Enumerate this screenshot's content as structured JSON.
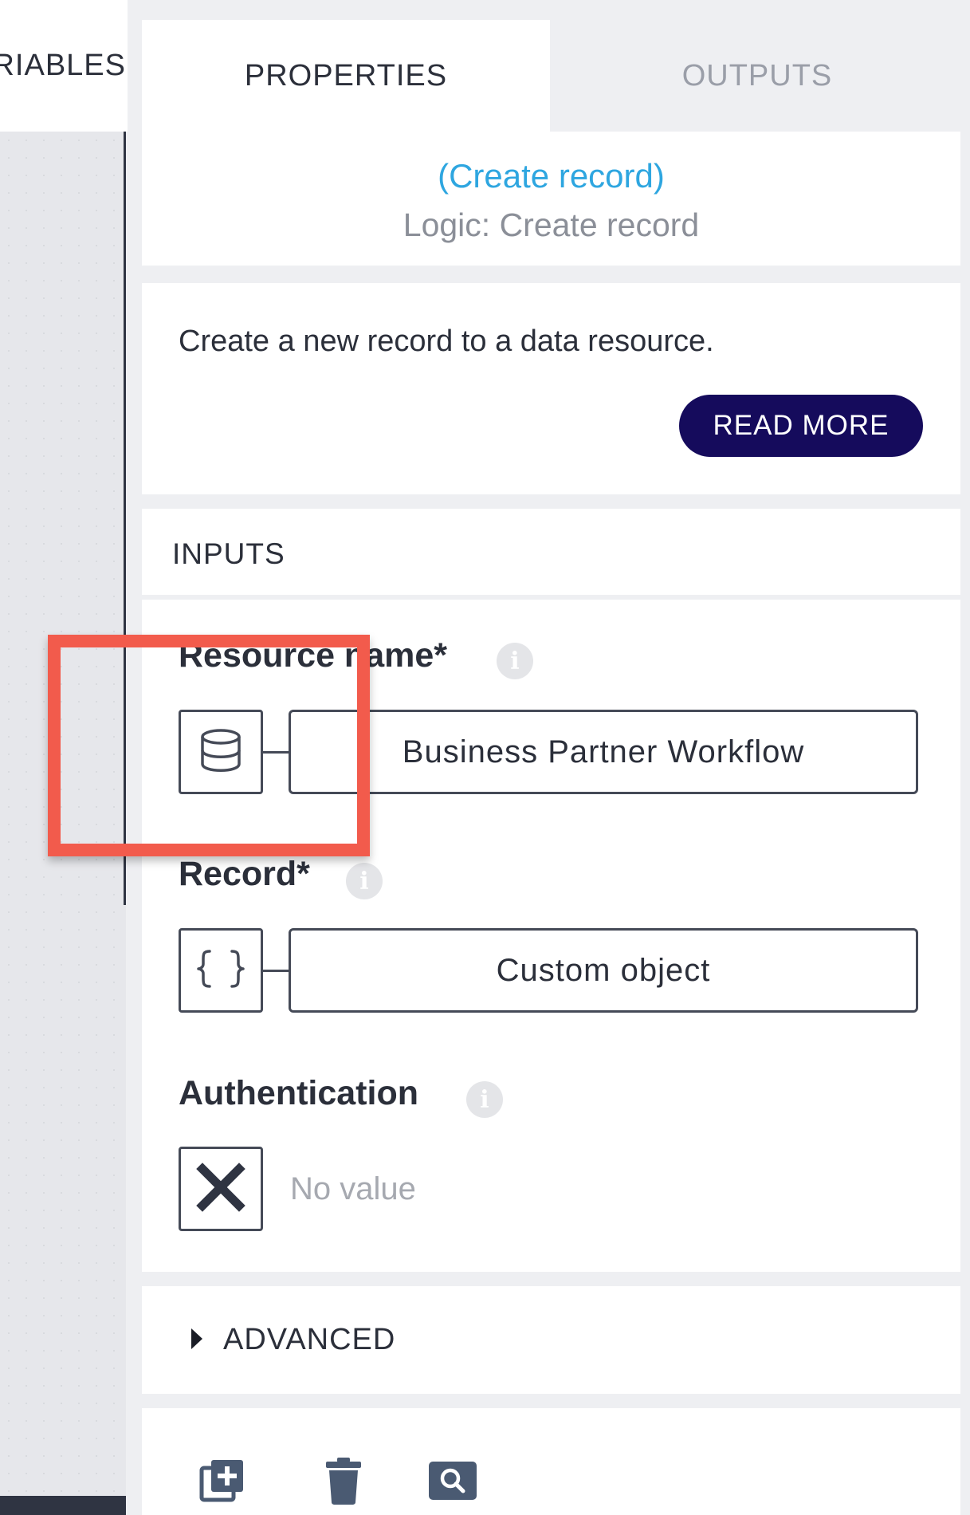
{
  "tabs": {
    "variables": "RIABLES",
    "properties": "PROPERTIES",
    "outputs": "OUTPUTS",
    "active": "PROPERTIES"
  },
  "header": {
    "record_link": "(Create record)",
    "subtitle": "Logic: Create record"
  },
  "description": {
    "text": "Create a new record to a data resource.",
    "read_more_label": "READ MORE"
  },
  "inputs": {
    "heading": "INPUTS",
    "fields": [
      {
        "label": "Resource name*",
        "type_icon": "database-icon",
        "value": "Business Partner Workflow"
      },
      {
        "label": "Record*",
        "type_icon": "braces-icon",
        "value": "Custom object"
      },
      {
        "label": "Authentication",
        "type_icon": "x-icon",
        "value": "No value"
      }
    ]
  },
  "advanced": {
    "label": "ADVANCED"
  },
  "toolbar": {
    "icons": [
      "duplicate-icon",
      "trash-icon",
      "search-icon"
    ]
  },
  "colors": {
    "link": "#2ea6e0",
    "primary_button": "#150b5c",
    "highlight": "#f25b4c",
    "border": "#454a57",
    "muted_text": "#8b8f98"
  }
}
